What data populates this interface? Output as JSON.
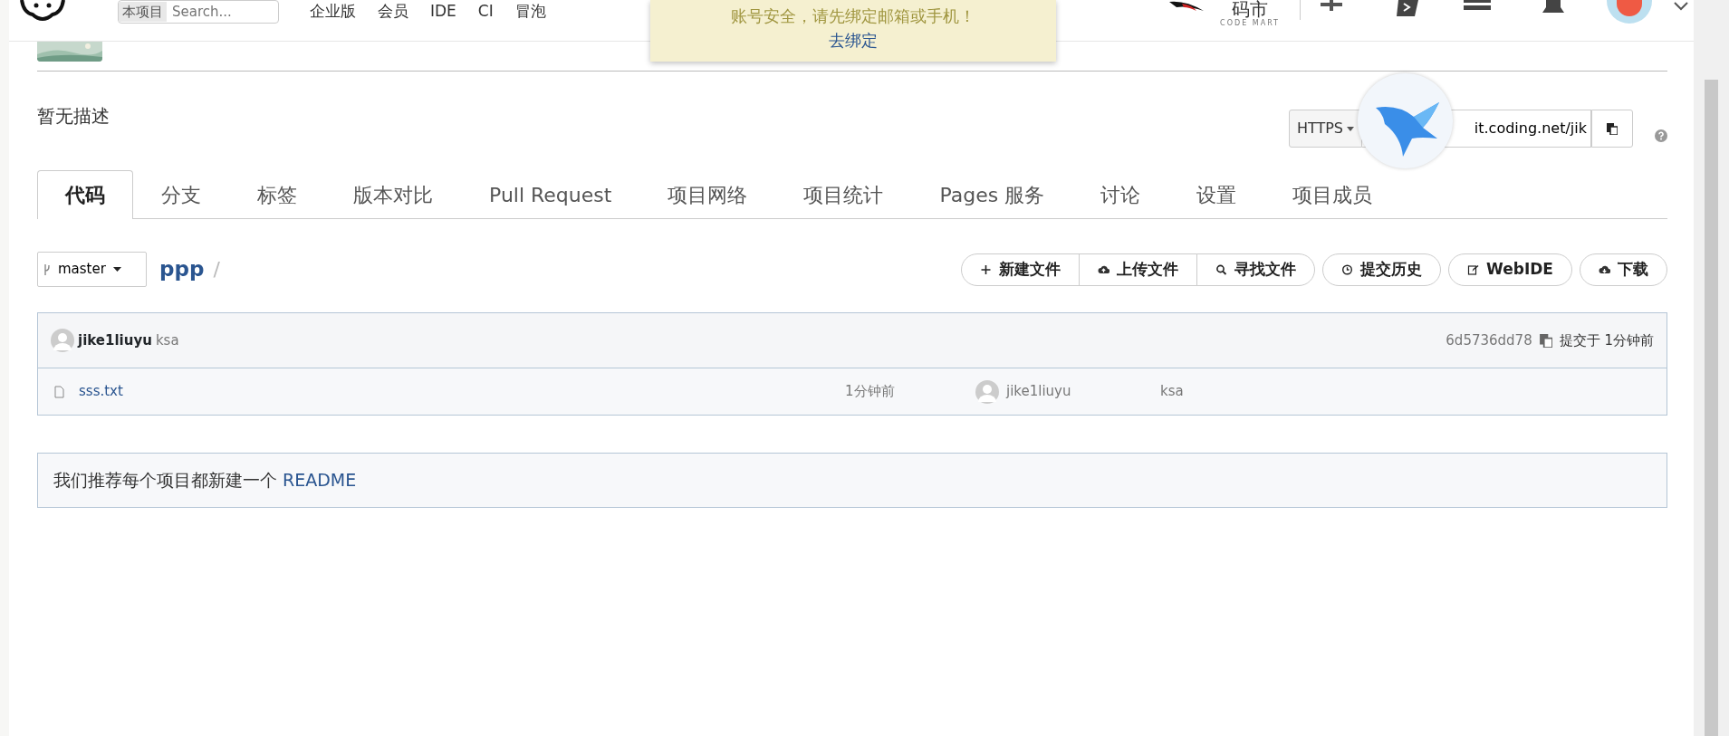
{
  "top_nav": {
    "search_scope": "本项目",
    "search_placeholder": "Search...",
    "links": [
      "企业版",
      "会员",
      "IDE",
      "CI",
      "冒泡"
    ],
    "brand": {
      "name": "码市",
      "tagline": "CODE MART"
    }
  },
  "notice": {
    "message": "账号安全，请先绑定邮箱或手机！",
    "link": "去绑定"
  },
  "project": {
    "description": "暂无描述",
    "clone": {
      "protocol": "HTTPS",
      "url": "it.coding.net/jik"
    }
  },
  "tabs": [
    {
      "label": "代码",
      "selected": true
    },
    {
      "label": "分支",
      "selected": false
    },
    {
      "label": "标签",
      "selected": false
    },
    {
      "label": "版本对比",
      "selected": false
    },
    {
      "label": "Pull Request",
      "selected": false
    },
    {
      "label": "项目网络",
      "selected": false
    },
    {
      "label": "项目统计",
      "selected": false
    },
    {
      "label": "Pages 服务",
      "selected": false
    },
    {
      "label": "讨论",
      "selected": false
    },
    {
      "label": "设置",
      "selected": false
    },
    {
      "label": "项目成员",
      "selected": false
    }
  ],
  "toolbar": {
    "branch": "master",
    "path": "ppp",
    "separator": "/",
    "actions": [
      {
        "label": "新建文件",
        "kind": "plus",
        "grouped": true
      },
      {
        "label": "上传文件",
        "kind": "upload",
        "grouped": true
      },
      {
        "label": "寻找文件",
        "kind": "search",
        "grouped": true
      },
      {
        "label": "提交历史",
        "kind": "history",
        "grouped": false
      },
      {
        "label": "WebIDE",
        "kind": "edit",
        "grouped": false
      },
      {
        "label": "下载",
        "kind": "download",
        "grouped": false
      }
    ]
  },
  "commit": {
    "author": "jike1liuyu",
    "message": "ksa",
    "hash": "6d5736dd78",
    "time": "提交于 1分钟前"
  },
  "files": [
    {
      "name": "sss.txt",
      "time": "1分钟前",
      "author": "jike1liuyu",
      "message": "ksa"
    }
  ],
  "readme_hint": {
    "text": "我们推荐每个项目都新建一个",
    "link": "README"
  }
}
